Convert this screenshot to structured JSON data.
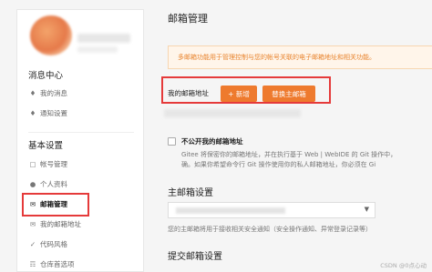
{
  "sidebar": {
    "section_messages": "消息中心",
    "items_messages": [
      {
        "label": "我的消息",
        "icon": "bell-icon"
      },
      {
        "label": "通知设置",
        "icon": "bell-settings-icon"
      }
    ],
    "section_basic": "基本设置",
    "items_basic": [
      {
        "label": "帐号管理",
        "icon": "account-icon"
      },
      {
        "label": "个人资料",
        "icon": "user-icon"
      },
      {
        "label": "邮箱管理",
        "icon": "mail-icon"
      },
      {
        "label": "我的邮箱地址",
        "icon": "mail-address-icon"
      },
      {
        "label": "代码风格",
        "icon": "code-icon"
      },
      {
        "label": "仓库首选项",
        "icon": "repo-icon"
      }
    ]
  },
  "main": {
    "title": "邮箱管理",
    "notice": "多邮箱功能用于管理控制与您的帐号关联的电子邮箱地址和相关功能。",
    "address_label": "我的邮箱地址",
    "add_button": "+ 新增",
    "replace_button": "替换主邮箱",
    "private_checkbox_label": "不公开我的邮箱地址",
    "private_desc_1": "Gitee 将保密你的邮箱地址，并在执行基于 Web | WebIDE 的 Git 操作中，",
    "private_desc_2": "确。如果你希望命令行 Git 操作使用你的私人邮箱地址，你必须在 Gi",
    "primary_title": "主邮箱设置",
    "primary_hint": "您的主邮箱将用于接收相关安全通知（安全操作通知、异常登录记录等）",
    "commit_title": "提交邮箱设置"
  },
  "watermark": "CSDN @0点心动",
  "colors": {
    "accent": "#ee7a2e",
    "highlight_box": "#e53a3a",
    "notice_text": "#e8842e"
  }
}
